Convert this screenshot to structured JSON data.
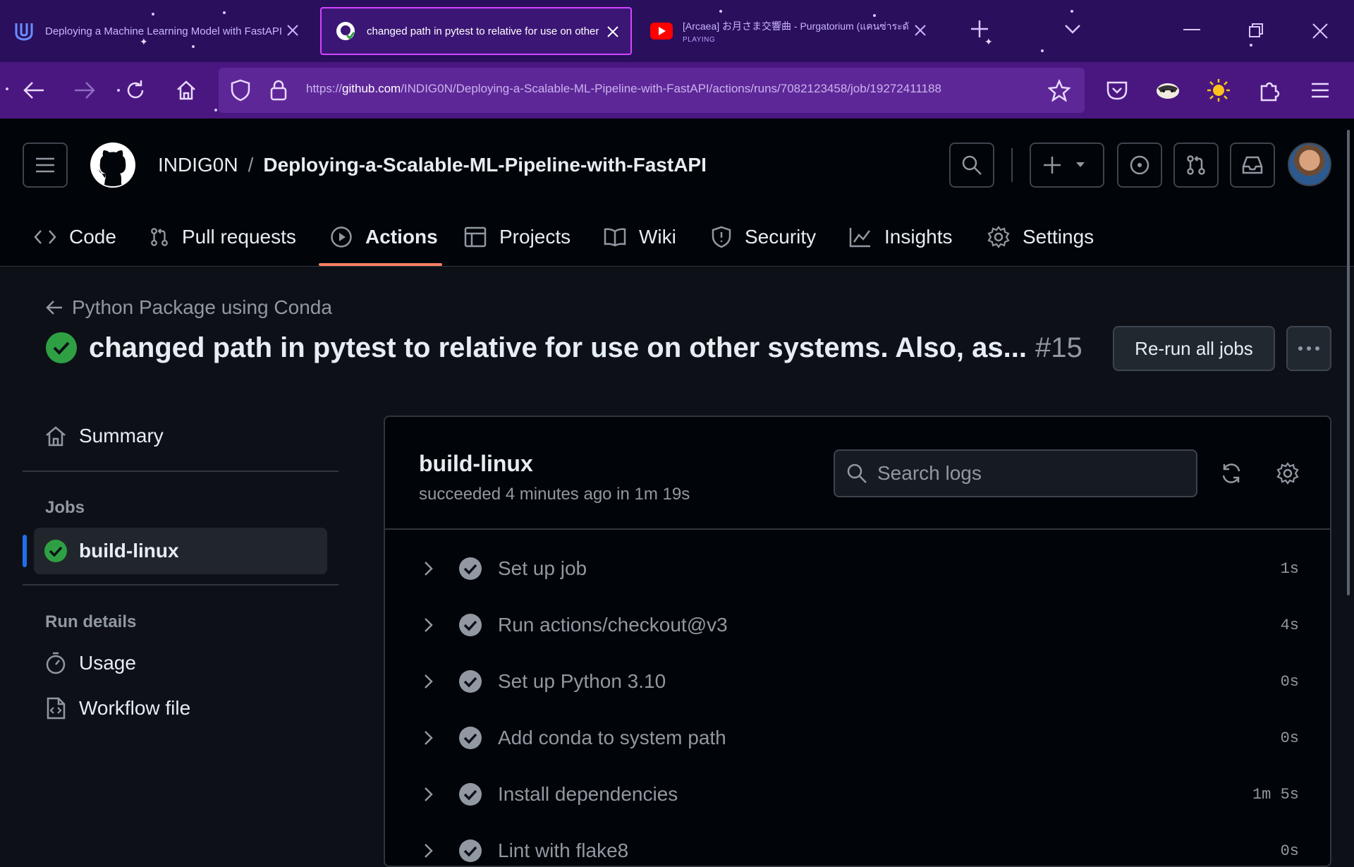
{
  "browser": {
    "tabs": [
      {
        "title": "Deploying a Machine Learning Model with FastAPI",
        "icon": "udacity-icon"
      },
      {
        "title": "changed path in pytest to relative for use on other",
        "icon": "github-icon"
      },
      {
        "title": "[Arcaea] お月さま交響曲 - Purgatorium (แคนซ่าระดั",
        "subtitle": "PLAYING",
        "icon": "youtube-icon"
      }
    ],
    "url_prefix": "https://",
    "url_domain": "github.com",
    "url_path": "/INDIG0N/Deploying-a-Scalable-ML-Pipeline-with-FastAPI/actions/runs/7082123458/job/19272411188"
  },
  "github": {
    "owner": "INDIG0N",
    "repo": "Deploying-a-Scalable-ML-Pipeline-with-FastAPI",
    "tabs": [
      {
        "label": "Code",
        "icon": "code-icon"
      },
      {
        "label": "Pull requests",
        "icon": "pull-request-icon"
      },
      {
        "label": "Actions",
        "icon": "play-icon",
        "active": true
      },
      {
        "label": "Projects",
        "icon": "table-icon"
      },
      {
        "label": "Wiki",
        "icon": "book-icon"
      },
      {
        "label": "Security",
        "icon": "shield-icon"
      },
      {
        "label": "Insights",
        "icon": "graph-icon"
      },
      {
        "label": "Settings",
        "icon": "gear-icon"
      }
    ]
  },
  "run": {
    "workflow": "Python Package using Conda",
    "title": "changed path in pytest to relative for use on other systems. Also, as...",
    "number": "#15",
    "rerun_label": "Re-run all jobs"
  },
  "sidebar": {
    "summary": "Summary",
    "jobs_heading": "Jobs",
    "job": "build-linux",
    "run_details_heading": "Run details",
    "usage": "Usage",
    "workflow_file": "Workflow file"
  },
  "job": {
    "name": "build-linux",
    "meta": "succeeded 4 minutes ago in 1m 19s",
    "search_placeholder": "Search logs",
    "steps": [
      {
        "name": "Set up job",
        "duration": "1s"
      },
      {
        "name": "Run actions/checkout@v3",
        "duration": "4s"
      },
      {
        "name": "Set up Python 3.10",
        "duration": "0s"
      },
      {
        "name": "Add conda to system path",
        "duration": "0s"
      },
      {
        "name": "Install dependencies",
        "duration": "1m 5s"
      },
      {
        "name": "Lint with flake8",
        "duration": "0s"
      }
    ]
  },
  "colors": {
    "success": "#2ea043",
    "accent": "#f78166",
    "selected_bar": "#1f6feb"
  }
}
